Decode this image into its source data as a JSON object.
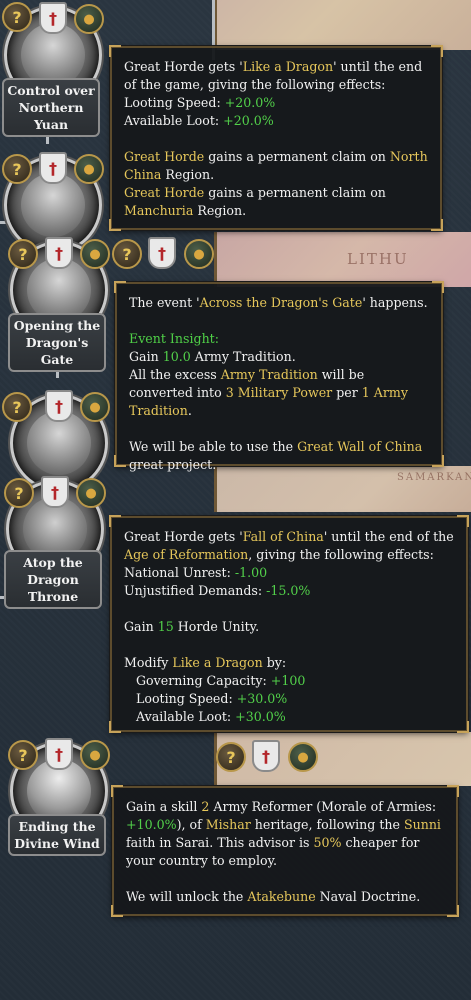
{
  "missions": [
    {
      "label": "Control over Northern Yuan"
    },
    {
      "label": ""
    },
    {
      "label": "Opening the Dragon's Gate"
    },
    {
      "label": ""
    },
    {
      "label": "Atop the Dragon Throne"
    },
    {
      "label": "Ending the Divine Wind"
    }
  ],
  "map_labels": {
    "a": "LITHU",
    "b": "SAMARKAND"
  },
  "badges": {
    "question": "?",
    "shield": "†",
    "medal": "●"
  },
  "tooltip1": {
    "l1_a": "Great Horde gets '",
    "l1_b": "Like a Dragon",
    "l1_c": "' until the end of the game, giving the following effects:",
    "l2_a": "Looting Speed: ",
    "l2_b": "+20.0%",
    "l3_a": "Available Loot: ",
    "l3_b": "+20.0%",
    "l4_a": "Great Horde",
    "l4_b": " gains a permanent claim on ",
    "l4_c": "North China",
    "l4_d": " Region.",
    "l5_a": "Great Horde",
    "l5_b": " gains a permanent claim on ",
    "l5_c": "Manchuria",
    "l5_d": " Region."
  },
  "tooltip2": {
    "l1_a": "The event '",
    "l1_b": "Across the Dragon's Gate",
    "l1_c": "' happens.",
    "insight": "Event Insight:",
    "l2_a": "Gain ",
    "l2_b": "10.0",
    "l2_c": " Army Tradition.",
    "l3_a": "All the excess ",
    "l3_b": "Army Tradition",
    "l3_c": " will be converted into ",
    "l3_d": "3 Military Power",
    "l3_e": " per ",
    "l3_f": "1",
    "l3_g": " ",
    "l3_h": "Army Tradition",
    "l3_i": ".",
    "l4_a": "We will be able to use the ",
    "l4_b": "Great Wall of China",
    "l4_c": " great project."
  },
  "tooltip3": {
    "l1_a": "Great Horde gets '",
    "l1_b": "Fall of China",
    "l1_c": "' until the end of the ",
    "l1_d": "Age of Reformation",
    "l1_e": ", giving the following effects:",
    "l2_a": "National Unrest: ",
    "l2_b": "-1.00",
    "l3_a": "Unjustified Demands: ",
    "l3_b": "-15.0%",
    "l4_a": "Gain ",
    "l4_b": "15",
    "l4_c": " Horde Unity.",
    "l5_a": "Modify ",
    "l5_b": "Like a Dragon",
    "l5_c": " by:",
    "l6_a": "Governing Capacity: ",
    "l6_b": "+100",
    "l7_a": "Looting Speed: ",
    "l7_b": "+30.0%",
    "l8_a": "Available Loot: ",
    "l8_b": "+30.0%"
  },
  "tooltip4": {
    "l1_a": "Gain a skill ",
    "l1_b": "2",
    "l1_c": " Army Reformer (Morale of Armies: ",
    "l1_d": "+10.0%",
    "l1_e": "), of ",
    "l1_f": "Mishar",
    "l1_g": " heritage, following the ",
    "l1_h": "Sunni",
    "l1_i": " faith in Sarai. This advisor is ",
    "l1_j": "50%",
    "l1_k": " cheaper for your country to employ.",
    "l2_a": "We will unlock the ",
    "l2_b": "Atakebune",
    "l2_c": " Naval Doctrine."
  }
}
